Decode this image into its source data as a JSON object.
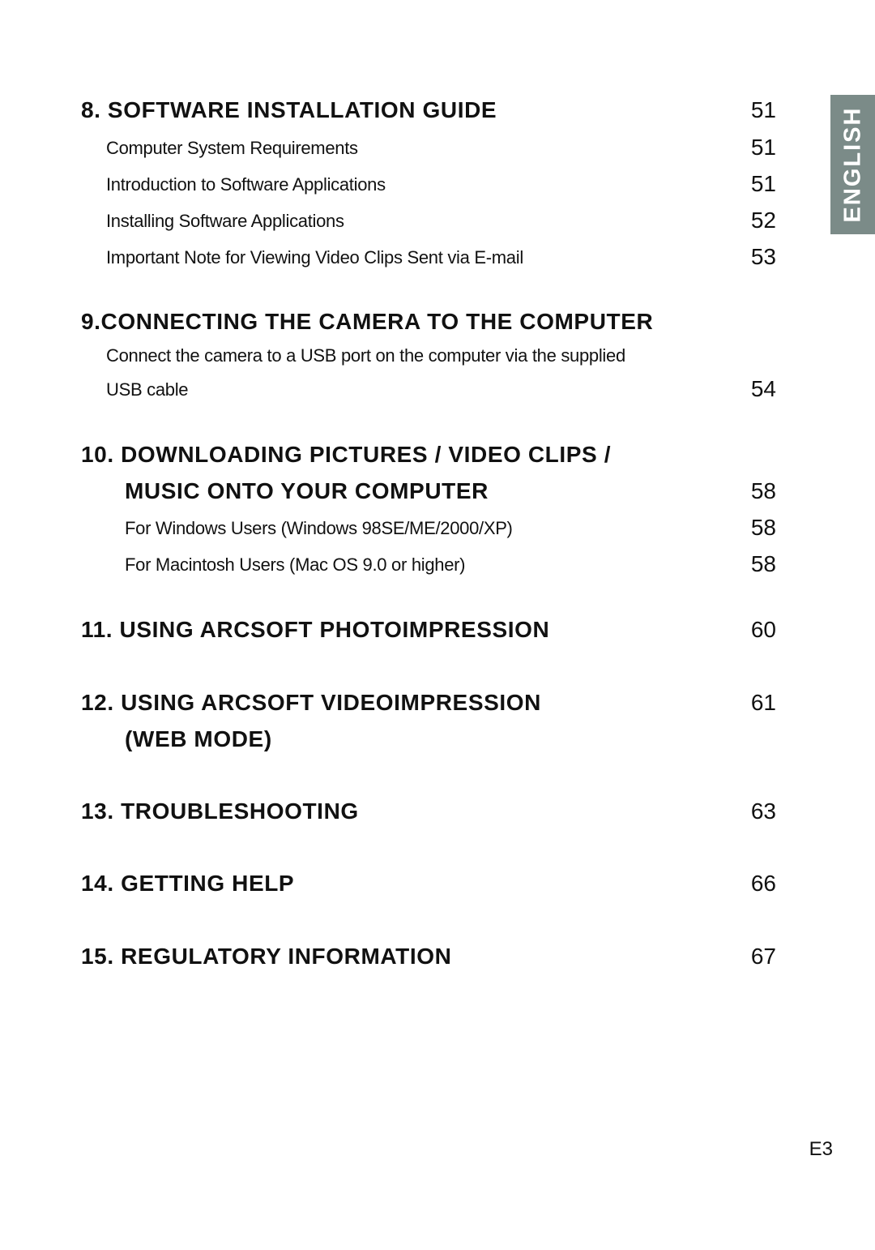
{
  "side_tab": {
    "label": "ENGLISH"
  },
  "toc": [
    {
      "heading": "8. SOFTWARE INSTALLATION GUIDE",
      "page": "51",
      "items": [
        {
          "label": "Computer System Requirements",
          "page": "51"
        },
        {
          "label": "Introduction to Software Applications",
          "page": "51"
        },
        {
          "label": "Installing Software Applications",
          "page": "52"
        },
        {
          "label": "Important Note for Viewing Video Clips Sent via E-mail",
          "page": "53"
        }
      ]
    },
    {
      "heading": "9.CONNECTING THE CAMERA TO THE COMPUTER",
      "page": "",
      "items": [
        {
          "label_line1": "Connect the camera to a USB port on the computer via the supplied",
          "label_line2": "USB cable",
          "page": "54"
        }
      ]
    },
    {
      "heading_line1": "10. DOWNLOADING PICTURES / VIDEO CLIPS /",
      "heading_line2": "MUSIC ONTO YOUR COMPUTER",
      "page": "58",
      "items": [
        {
          "label": "For Windows Users (Windows 98SE/ME/2000/XP)",
          "page": "58"
        },
        {
          "label": "For Macintosh Users (Mac OS 9.0 or higher)",
          "page": "58"
        }
      ]
    },
    {
      "heading": "11. USING ARCSOFT PHOTOIMPRESSION",
      "page": "60"
    },
    {
      "heading_line1": "12. USING ARCSOFT VIDEOIMPRESSION",
      "heading_line2": "(WEB MODE)",
      "page": "61"
    },
    {
      "heading": "13. TROUBLESHOOTING",
      "page": "63"
    },
    {
      "heading": "14. GETTING HELP",
      "page": "66"
    },
    {
      "heading": "15. REGULATORY INFORMATION",
      "page": "67"
    }
  ],
  "footer": {
    "page_label": "E3"
  }
}
